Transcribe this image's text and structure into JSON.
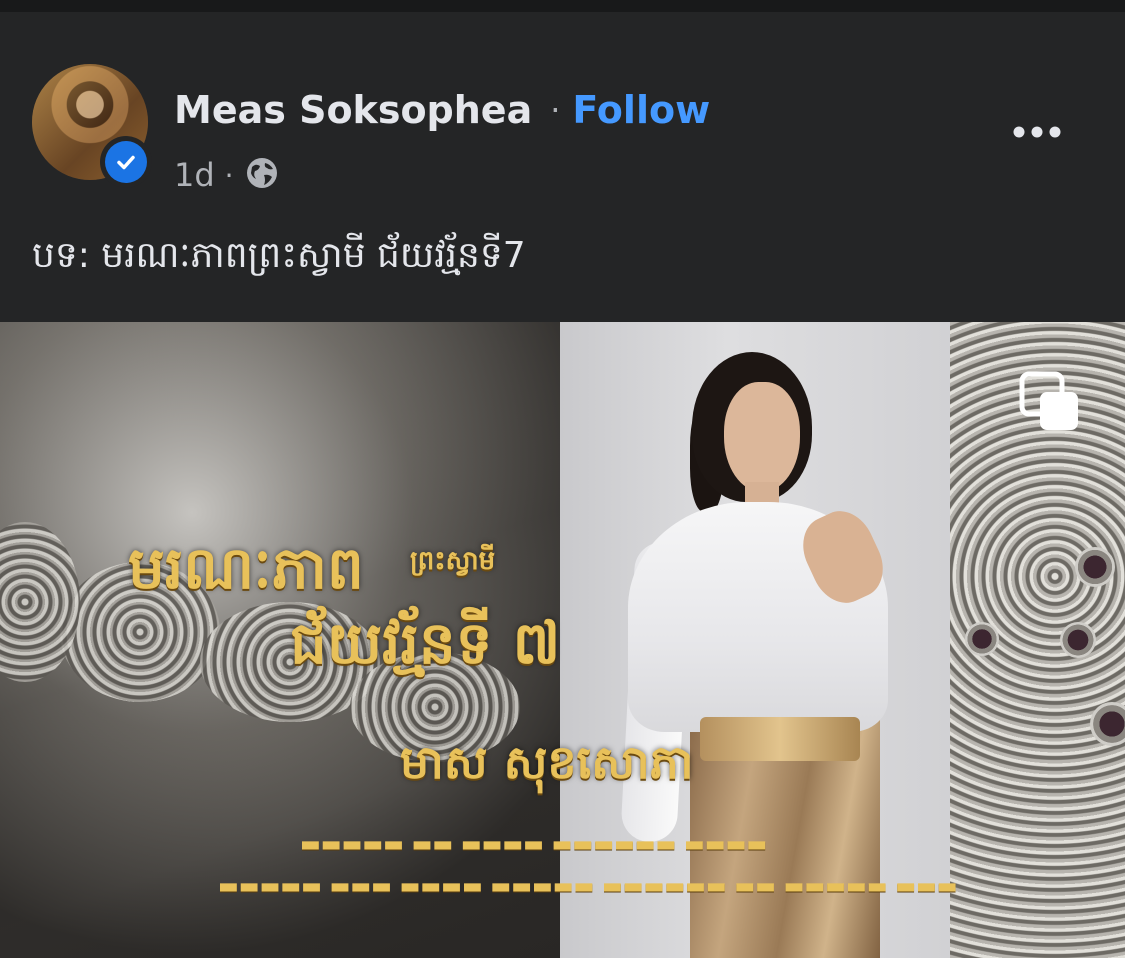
{
  "post": {
    "author": "Meas Soksophea",
    "separator": "·",
    "follow_label": "Follow",
    "time": "1d",
    "meta_separator": "·",
    "audience_icon": "globe-icon",
    "verified_icon": "verified-badge-icon",
    "more_icon": "more-options-icon",
    "caption": "បទ: មរណៈភាពព្រះស្វាមី ជ័យវរ្ម័នទី7"
  },
  "media": {
    "title_line1": "មរណៈភាព",
    "title_line1_small": "ព្រះស្វាមី",
    "title_line2": "ជ័យវរ្ម័នទី ៧",
    "singer": "មាស សុខសោភា",
    "multi_icon": "multiple-media-icon"
  },
  "colors": {
    "background": "#242526",
    "text_primary": "#e4e6eb",
    "text_secondary": "#b0b3b8",
    "link": "#4599ff",
    "verified": "#1b74e4",
    "gold_title": "#e8c15a"
  }
}
